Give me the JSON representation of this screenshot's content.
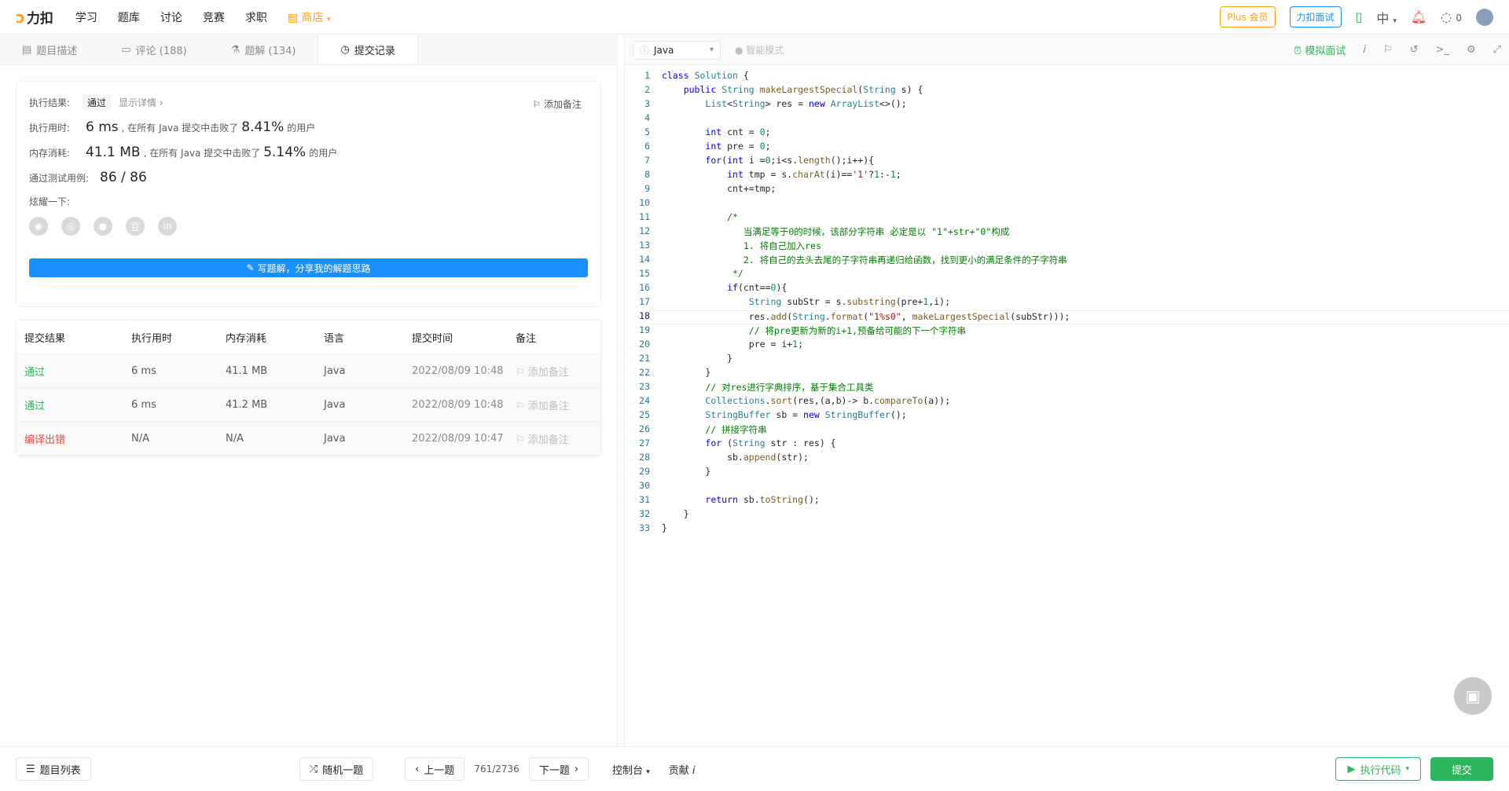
{
  "nav": {
    "logo_text": "力扣",
    "items": [
      "学习",
      "题库",
      "讨论",
      "竞赛",
      "求职"
    ],
    "shop": "商店",
    "plus": "Plus 会员",
    "interview": "力扣面试",
    "lang": "中",
    "points": "0"
  },
  "tabs": [
    {
      "label": "题目描述"
    },
    {
      "label": "评论 (188)"
    },
    {
      "label": "题解 (134)"
    },
    {
      "label": "提交记录"
    }
  ],
  "result": {
    "status_label": "执行结果:",
    "status": "通过",
    "detail_link": "显示详情 ›",
    "add_note": "添加备注",
    "time_label": "执行用时:",
    "time_value": "6 ms",
    "time_mid": ", 在所有 Java 提交中击败了",
    "time_pct": "8.41%",
    "time_suffix": "的用户",
    "mem_label": "内存消耗:",
    "mem_value": "41.1 MB",
    "mem_mid": ", 在所有 Java 提交中击败了",
    "mem_pct": "5.14%",
    "mem_suffix": "的用户",
    "tests_label": "通过测试用例:",
    "tests_value": "86 / 86",
    "share_label": "炫耀一下:",
    "write_btn": "写题解，分享我的解题思路"
  },
  "submissions": {
    "headers": [
      "提交结果",
      "执行用时",
      "内存消耗",
      "语言",
      "提交时间",
      "备注"
    ],
    "rows": [
      {
        "result": "通过",
        "time": "6 ms",
        "mem": "41.1 MB",
        "lang": "Java",
        "date": "2022/08/09 10:48",
        "note": "添加备注"
      },
      {
        "result": "通过",
        "time": "6 ms",
        "mem": "41.2 MB",
        "lang": "Java",
        "date": "2022/08/09 10:48",
        "note": "添加备注"
      },
      {
        "result": "编译出错",
        "time": "N/A",
        "mem": "N/A",
        "lang": "Java",
        "date": "2022/08/09 10:47",
        "note": "添加备注"
      }
    ]
  },
  "editor": {
    "language": "Java",
    "smart_mode": "智能模式",
    "mock_interview": "模拟面试"
  },
  "bottom": {
    "problem_list": "题目列表",
    "random": "随机一题",
    "prev": "上一题",
    "pager": "761/2736",
    "next": "下一题",
    "console": "控制台",
    "contribute": "贡献",
    "run": "执行代码",
    "submit": "提交"
  },
  "colors": {
    "accent_green": "#2db55d",
    "accent_blue": "#1a90ff",
    "brand_orange": "#ffa116",
    "error_red": "#ef4743"
  }
}
